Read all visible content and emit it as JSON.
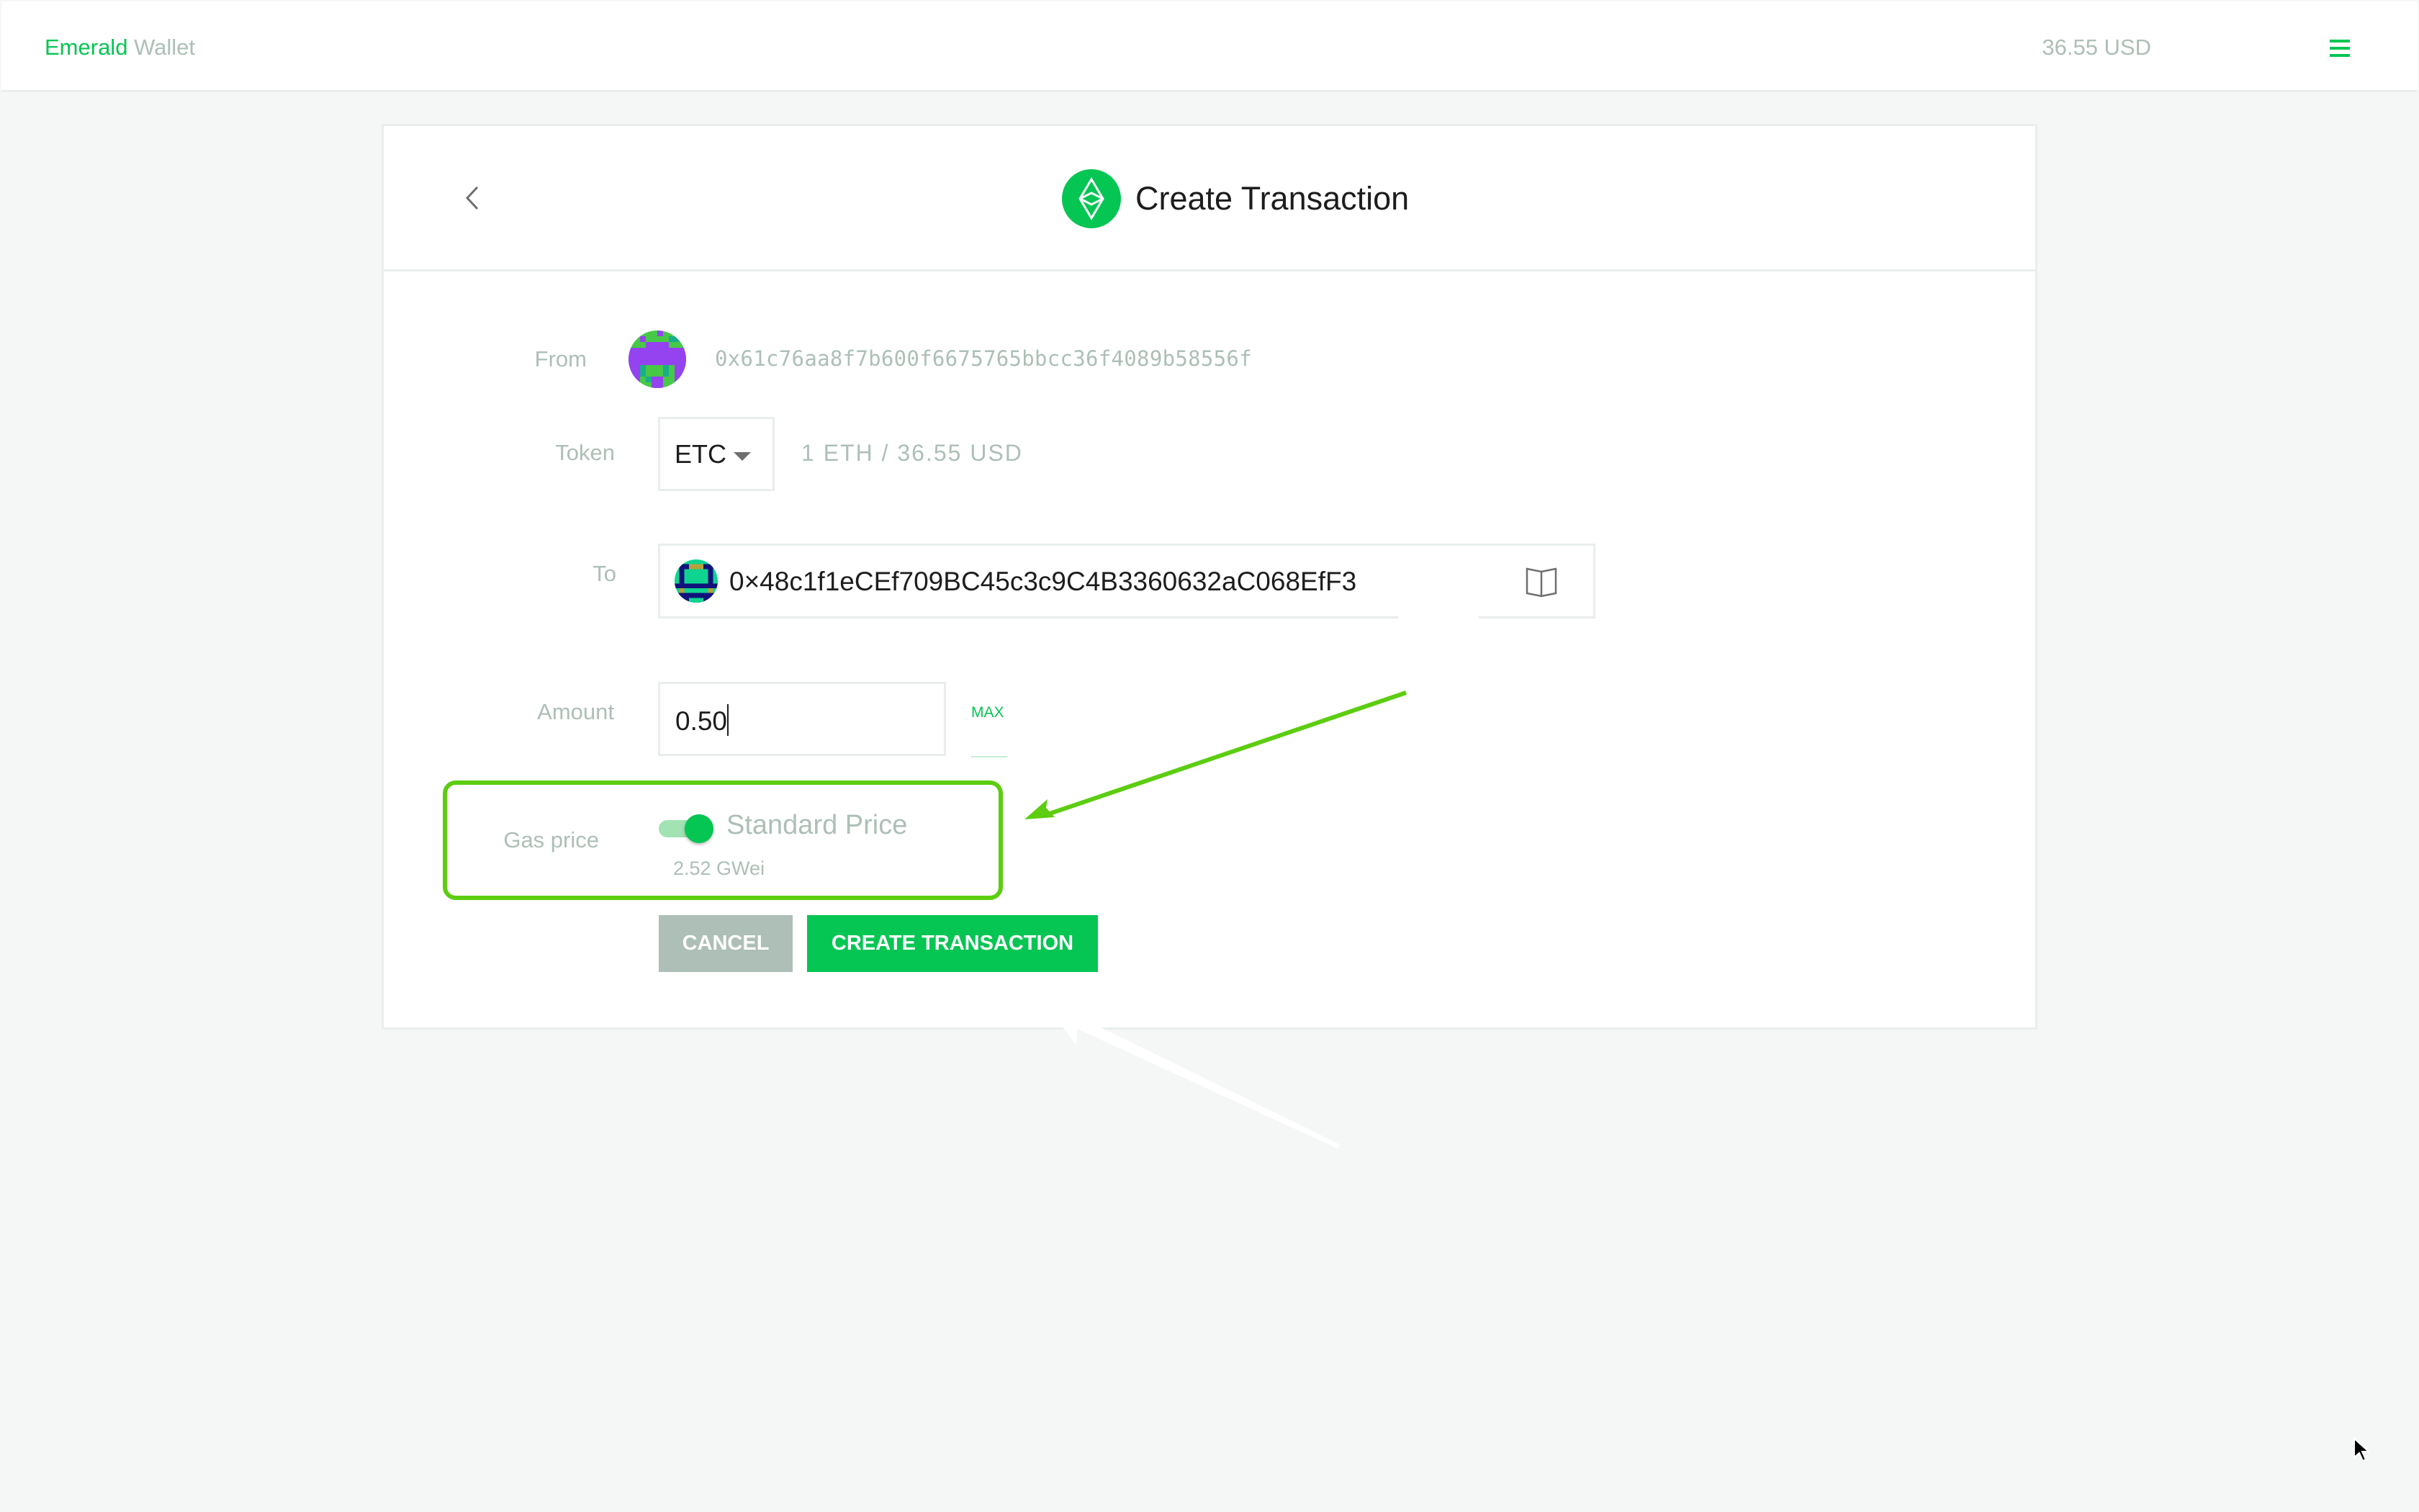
{
  "header": {
    "brand_primary": "Emerald",
    "brand_secondary": "Wallet",
    "balance": "36.55 USD",
    "menu_icon": "hamburger-menu-icon"
  },
  "page": {
    "title": "Create Transaction",
    "title_icon": "ethereum-classic-icon",
    "back_icon": "chevron-left-icon"
  },
  "form": {
    "from": {
      "label": "From",
      "address": "0x61c76aa8f7b600f6675765bbcc36f4089b58556f"
    },
    "token": {
      "label": "Token",
      "selected": "ETC",
      "rate": "1 ETH / 36.55 USD"
    },
    "to": {
      "label": "To",
      "address": "0×48c1f1eCEf709BC45c3c9C4B3360632aC068EfF3",
      "address_book_icon": "book-icon"
    },
    "amount": {
      "label": "Amount",
      "value": "0.50",
      "max_label": "MAX"
    },
    "gas_price": {
      "label": "Gas price",
      "mode": "Standard Price",
      "toggle_on": true,
      "value": "2.52 GWei"
    },
    "buttons": {
      "cancel": "CANCEL",
      "create": "CREATE TRANSACTION"
    }
  },
  "colors": {
    "accent": "#05c553",
    "muted": "#adbfb6",
    "annotation": "#5ccd10"
  }
}
